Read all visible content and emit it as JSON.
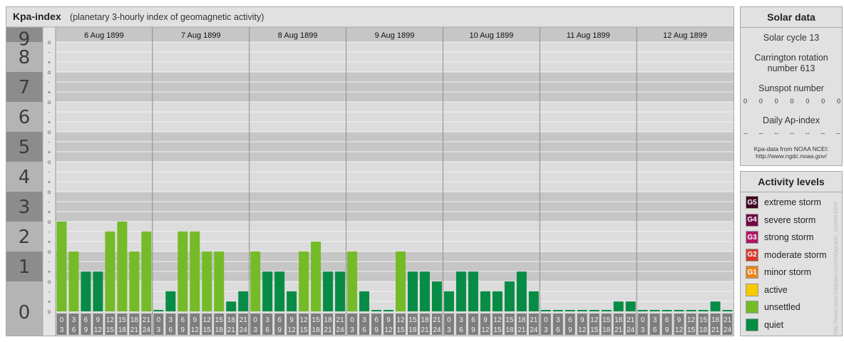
{
  "header": {
    "title": "Kpa-index",
    "subtitle": "(planetary 3-hourly index of geomagnetic activity)"
  },
  "chart_data": {
    "type": "bar",
    "title": "Kpa-index",
    "subtitle": "(planetary 3-hourly index of geomagnetic activity)",
    "ylim": [
      0,
      9
    ],
    "y_ticks": [
      "0",
      "1",
      "2",
      "3",
      "4",
      "5",
      "6",
      "7",
      "8",
      "9"
    ],
    "sub_ticks": [
      "o",
      "+",
      "-"
    ],
    "days": [
      {
        "date": "6 Aug 1899",
        "values": [
          3.0,
          2.0,
          1.33,
          1.33,
          2.67,
          3.0,
          2.0,
          2.67
        ]
      },
      {
        "date": "7 Aug 1899",
        "values": [
          0.0,
          0.67,
          2.67,
          2.67,
          2.0,
          2.0,
          0.33,
          0.67
        ]
      },
      {
        "date": "8 Aug 1899",
        "values": [
          2.0,
          1.33,
          1.33,
          0.67,
          2.0,
          2.33,
          1.33,
          1.33
        ]
      },
      {
        "date": "9 Aug 1899",
        "values": [
          2.0,
          0.67,
          0.0,
          0.0,
          2.0,
          1.33,
          1.33,
          1.0
        ]
      },
      {
        "date": "10 Aug 1899",
        "values": [
          0.67,
          1.33,
          1.33,
          0.67,
          0.67,
          1.0,
          1.33,
          0.67
        ]
      },
      {
        "date": "11 Aug 1899",
        "values": [
          0.0,
          0.0,
          0.0,
          0.0,
          0.0,
          0.0,
          0.33,
          0.33
        ]
      },
      {
        "date": "12 Aug 1899",
        "values": [
          0.0,
          0.0,
          0.0,
          0.0,
          0.0,
          0.0,
          0.33,
          0.0
        ]
      }
    ],
    "hour_labels": [
      [
        "0",
        "3"
      ],
      [
        "3",
        "6"
      ],
      [
        "6",
        "9"
      ],
      [
        "9",
        "12"
      ],
      [
        "12",
        "15"
      ],
      [
        "15",
        "18"
      ],
      [
        "18",
        "21"
      ],
      [
        "21",
        "24"
      ]
    ],
    "colors": {
      "unsettled": "#74bb27",
      "quiet": "#078c45",
      "grid_band_dark": "#c6c6c6",
      "grid_band_light": "#dcdcdc",
      "label_band_dark": "#8c8c8c",
      "label_band_light": "#b4b4b4",
      "hour_cell": "#7e7e7e"
    }
  },
  "solar": {
    "heading": "Solar data",
    "cycle": "Solar cycle 13",
    "carrington_line1": "Carrington rotation",
    "carrington_line2": "number 613",
    "sunspot_heading": "Sunspot number",
    "sunspots": [
      "0",
      "0",
      "0",
      "0",
      "0",
      "0",
      "0"
    ],
    "ap_heading": "Daily Ap-index",
    "ap_values": [
      "--",
      "--",
      "--",
      "--",
      "--",
      "--",
      "--"
    ],
    "source_line1": "Kpa-data from NOAA NCEI:",
    "source_line2": "http://www.ngdc.noaa.gov/"
  },
  "activity": {
    "heading": "Activity levels",
    "levels": [
      {
        "code": "G5",
        "label": "extreme storm",
        "color": "#3d0025"
      },
      {
        "code": "G4",
        "label": "severe storm",
        "color": "#6e0a45"
      },
      {
        "code": "G3",
        "label": "strong storm",
        "color": "#b0176a"
      },
      {
        "code": "G2",
        "label": "moderate storm",
        "color": "#d5392a"
      },
      {
        "code": "G1",
        "label": "minor storm",
        "color": "#e8841c"
      },
      {
        "code": "",
        "label": "active",
        "color": "#f8c800"
      },
      {
        "code": "",
        "label": "unsettled",
        "color": "#74bb27"
      },
      {
        "code": "",
        "label": "quiet",
        "color": "#078c45"
      }
    ]
  },
  "watermark": "http://www.tesis.lebedev.ru/en/magnetic_storms.html"
}
